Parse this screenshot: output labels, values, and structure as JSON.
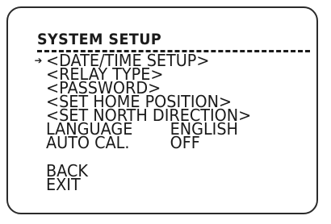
{
  "title": "SYSTEM SETUP",
  "cursor_icon": "pointer-arrow-icon",
  "cursor_glyph": "➔",
  "items": [
    {
      "label": "<DATE/TIME SETUP>"
    },
    {
      "label": "<RELAY TYPE>"
    },
    {
      "label": "<PASSWORD>"
    },
    {
      "label": "<SET HOME POSITION>"
    },
    {
      "label": "<SET NORTH DIRECTION>"
    },
    {
      "label": "LANGUAGE",
      "value": "ENGLISH"
    },
    {
      "label": "AUTO CAL.",
      "value": "OFF"
    }
  ],
  "back": "BACK",
  "exit": "EXIT"
}
